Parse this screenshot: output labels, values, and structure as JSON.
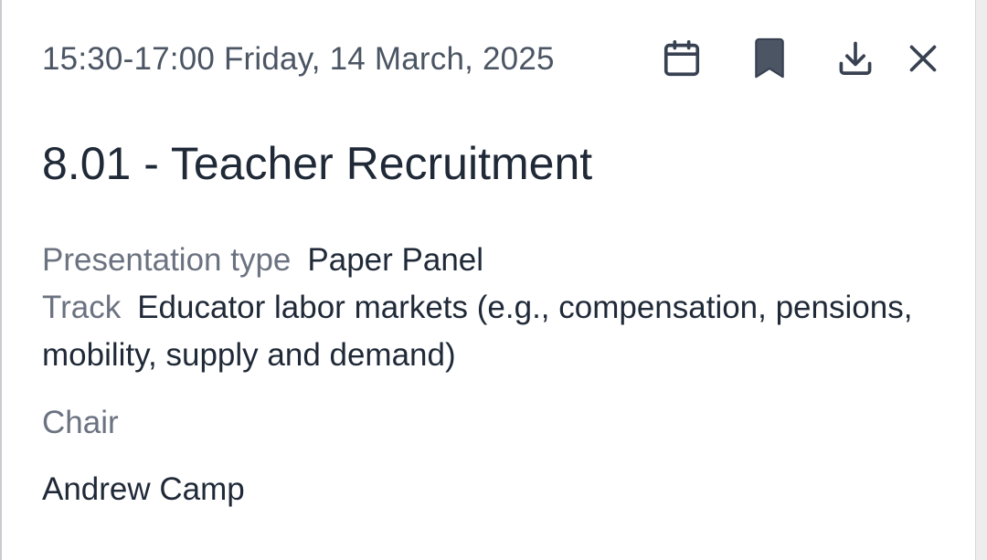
{
  "session": {
    "datetime": "15:30-17:00 Friday, 14 March, 2025",
    "title": "8.01 - Teacher Recruitment",
    "presentation_type_label": "Presentation type",
    "presentation_type_value": "Paper Panel",
    "track_label": "Track",
    "track_value": "Educator labor markets (e.g., compensation, pensions, mobility, supply and demand)",
    "chair_label": "Chair",
    "chair_name": "Andrew Camp"
  },
  "actions": {
    "calendar_icon": "calendar-icon",
    "bookmark_icon": "bookmark-icon",
    "download_icon": "download-icon",
    "close_icon": "close-icon"
  },
  "colors": {
    "text_primary": "#1f2937",
    "text_secondary": "#6b7280",
    "icon": "#374151",
    "bookmark_fill": "#4b5563"
  }
}
